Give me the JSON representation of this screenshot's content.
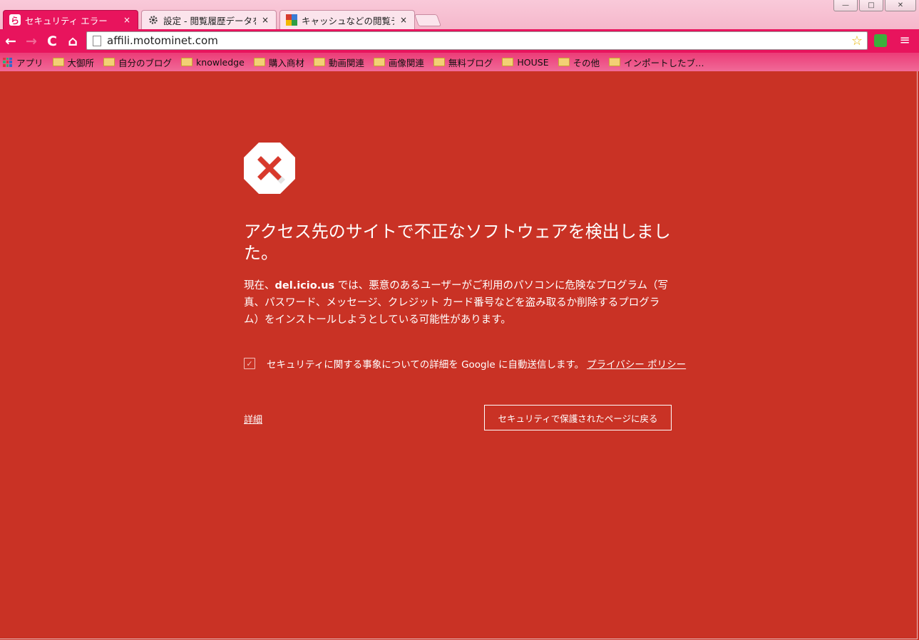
{
  "window": {
    "minimize": "—",
    "maximize": "□",
    "close": "✕"
  },
  "tabs": [
    {
      "title": "セキュリティ エラー",
      "active": true,
      "favicon": "ら"
    },
    {
      "title": "設定 - 閲覧履歴データを",
      "active": false,
      "favicon": "gear-icon"
    },
    {
      "title": "キャッシュなどの閲覧デ",
      "active": false,
      "favicon": "google-icon"
    }
  ],
  "tab_close": "×",
  "toolbar": {
    "back": "←",
    "forward": "→",
    "reload": "C",
    "home": "⌂",
    "url": "affili.motominet.com",
    "star": "☆",
    "menu": "≡"
  },
  "bookmarks": {
    "apps": "アプリ",
    "folders": [
      "大御所",
      "自分のブログ",
      "knowledge",
      "購入商材",
      "動画関連",
      "画像関連",
      "無料ブログ",
      "HOUSE",
      "その他",
      "インポートしたブ…"
    ]
  },
  "page": {
    "heading": "アクセス先のサイトで不正なソフトウェアを検出しました。",
    "explanation_prefix": "現在、",
    "explanation_site": "del.icio.us",
    "explanation_suffix": " では、悪意のあるユーザーがご利用のパソコンに危険なプログラム（写真、パスワード、メッセージ、クレジット カード番号などを盗み取るか削除するプログラム）をインストールしようとしている可能性があります。",
    "report_text": "セキュリティに関する事象についての詳細を Google に自動送信します。",
    "privacy_link": "プライバシー ポリシー",
    "details_link": "詳細",
    "back_button": "セキュリティで保護されたページに戻る",
    "report_checked": true
  },
  "colors": {
    "background": "#c93225",
    "toolbar": "#e8145d",
    "titlebar": "#f7c1d3"
  }
}
